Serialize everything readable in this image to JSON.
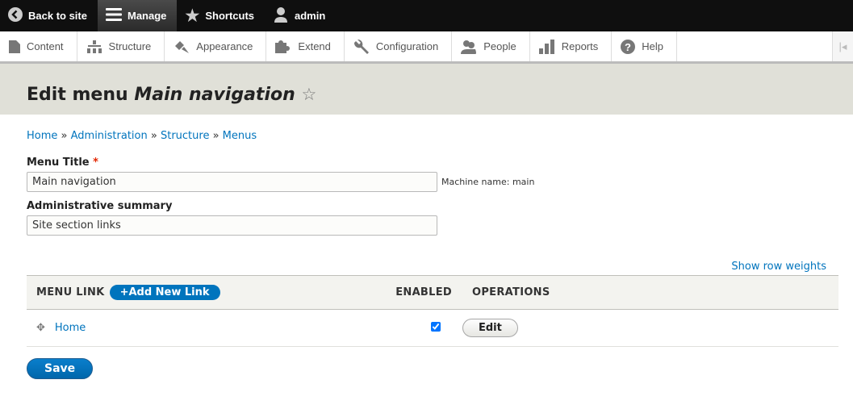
{
  "toolbar": {
    "back": "Back to site",
    "manage": "Manage",
    "shortcuts": "Shortcuts",
    "user": "admin"
  },
  "tabs": [
    "Content",
    "Structure",
    "Appearance",
    "Extend",
    "Configuration",
    "People",
    "Reports",
    "Help"
  ],
  "header": {
    "prefix": "Edit menu",
    "name": "Main navigation"
  },
  "breadcrumb": [
    "Home",
    "Administration",
    "Structure",
    "Menus"
  ],
  "form": {
    "title_label": "Menu Title",
    "title_req": "*",
    "title_value": "Main navigation",
    "machine": "Machine name: main",
    "summary_label": "Administrative summary",
    "summary_value": "Site section links"
  },
  "table": {
    "show_weights": "Show row weights",
    "headers": [
      "Menu link",
      "Enabled",
      "Operations"
    ],
    "add": "+Add New Link",
    "rows": [
      {
        "link": "Home",
        "enabled": true,
        "op": "Edit"
      }
    ]
  },
  "save": "Save"
}
